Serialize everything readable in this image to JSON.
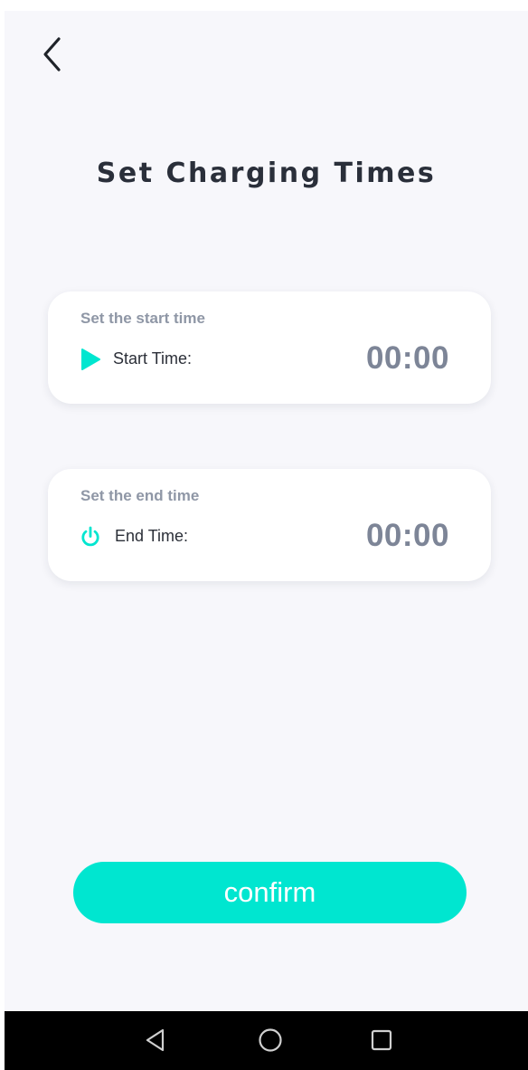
{
  "header": {
    "back_icon": "chevron-left-icon",
    "title": "Set Charging Times"
  },
  "start_card": {
    "caption": "Set the start time",
    "icon": "play-icon",
    "label": "Start Time:",
    "value": "00:00"
  },
  "end_card": {
    "caption": "Set the end time",
    "icon": "power-icon",
    "label": "End Time:",
    "value": "00:00"
  },
  "confirm": {
    "label": "confirm"
  },
  "nav_bar": {
    "back_icon": "triangle-back-icon",
    "home_icon": "circle-home-icon",
    "recents_icon": "square-recents-icon"
  },
  "colors": {
    "accent": "#00e6d0",
    "screen_background": "#f7f7fb",
    "title_text": "#2a2f3a",
    "caption_text": "#8f97a6",
    "time_value_text": "#7d8597",
    "nav_bar_background": "#000000"
  }
}
